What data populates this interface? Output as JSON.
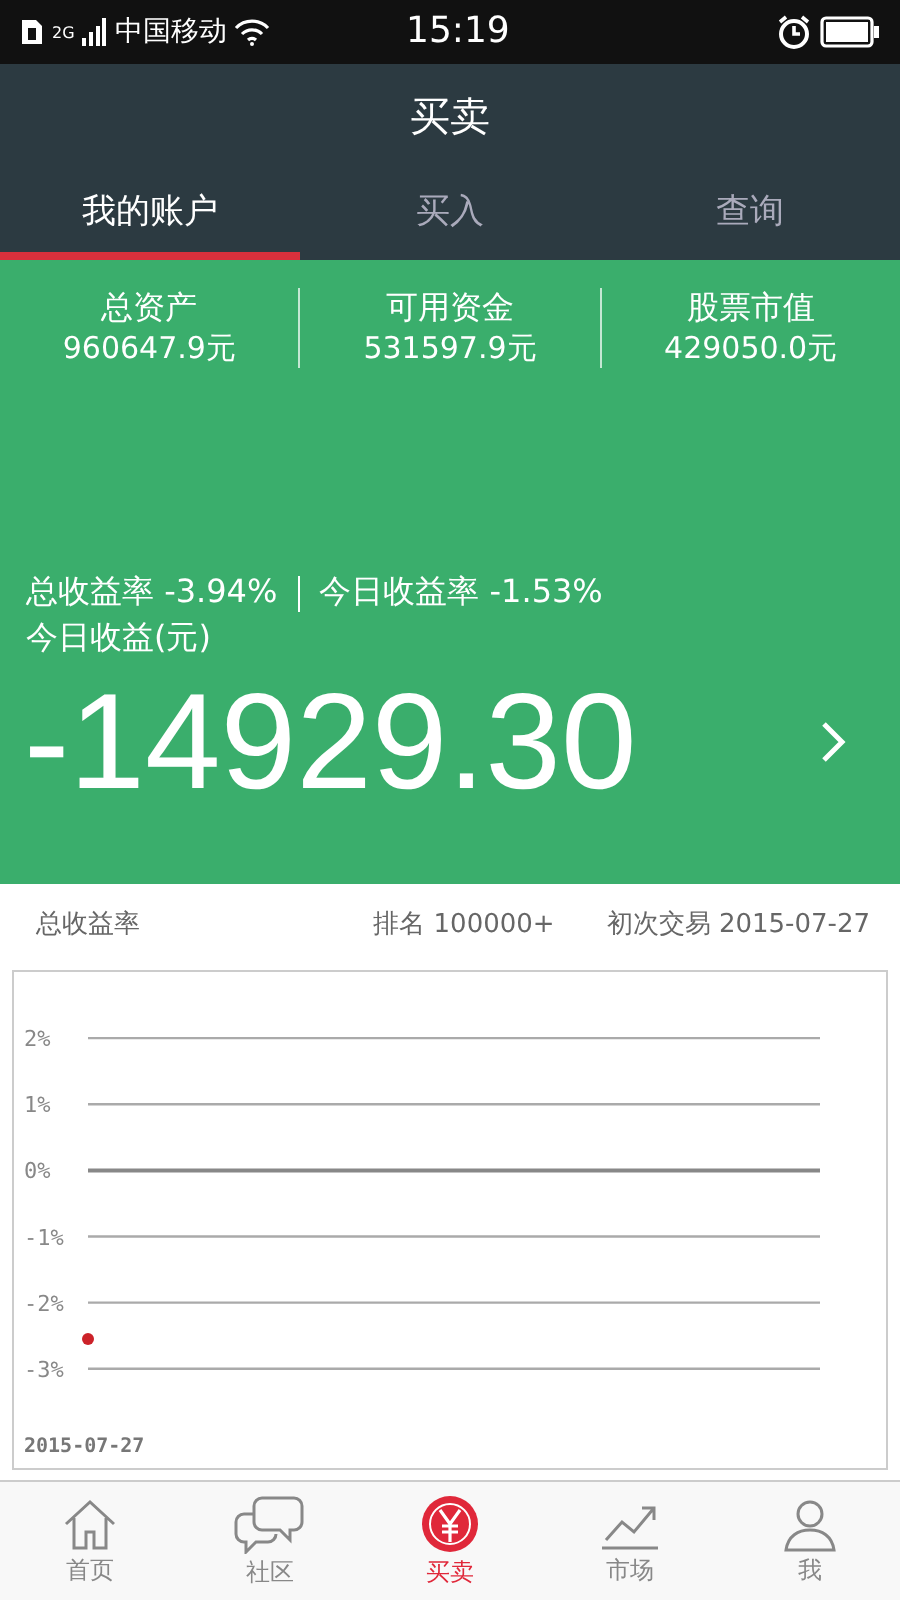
{
  "status_bar": {
    "network": "2G",
    "carrier": "中国移动",
    "time": "15:19"
  },
  "header": {
    "title": "买卖"
  },
  "tabs": [
    {
      "label": "我的账户",
      "selected": true
    },
    {
      "label": "买入",
      "selected": false
    },
    {
      "label": "查询",
      "selected": false
    }
  ],
  "summary": [
    {
      "label": "总资产",
      "value": "960647.9元"
    },
    {
      "label": "可用资金",
      "value": "531597.9元"
    },
    {
      "label": "股票市值",
      "value": "429050.0元"
    }
  ],
  "returns": {
    "total_rate": "总收益率 -3.94%",
    "today_rate": "今日收益率 -1.53%",
    "today_label": "今日收益(元)",
    "today_value": "-14929.30"
  },
  "chart_header": {
    "title": "总收益率",
    "rank": "排名 100000+",
    "first_trade": "初次交易 2015-07-27"
  },
  "chart": {
    "chart_data": {
      "type": "scatter",
      "x": [
        "2015-07-27"
      ],
      "ylim": [
        -4.5,
        3
      ],
      "grid": true,
      "yticks": [
        {
          "value": 2,
          "label": "2%"
        },
        {
          "value": 1,
          "label": "1%"
        },
        {
          "value": 0,
          "label": "0%"
        },
        {
          "value": -1,
          "label": "-1%"
        },
        {
          "value": -2,
          "label": "-2%"
        },
        {
          "value": -3,
          "label": "-3%"
        }
      ],
      "series": [
        {
          "color": "#cc2229",
          "values": [
            -2.55
          ]
        }
      ]
    }
  },
  "bottom_nav": [
    {
      "label": "首页",
      "selected": false
    },
    {
      "label": "社区",
      "selected": false
    },
    {
      "label": "买卖",
      "selected": true
    },
    {
      "label": "市场",
      "selected": false
    },
    {
      "label": "我",
      "selected": false
    }
  ]
}
